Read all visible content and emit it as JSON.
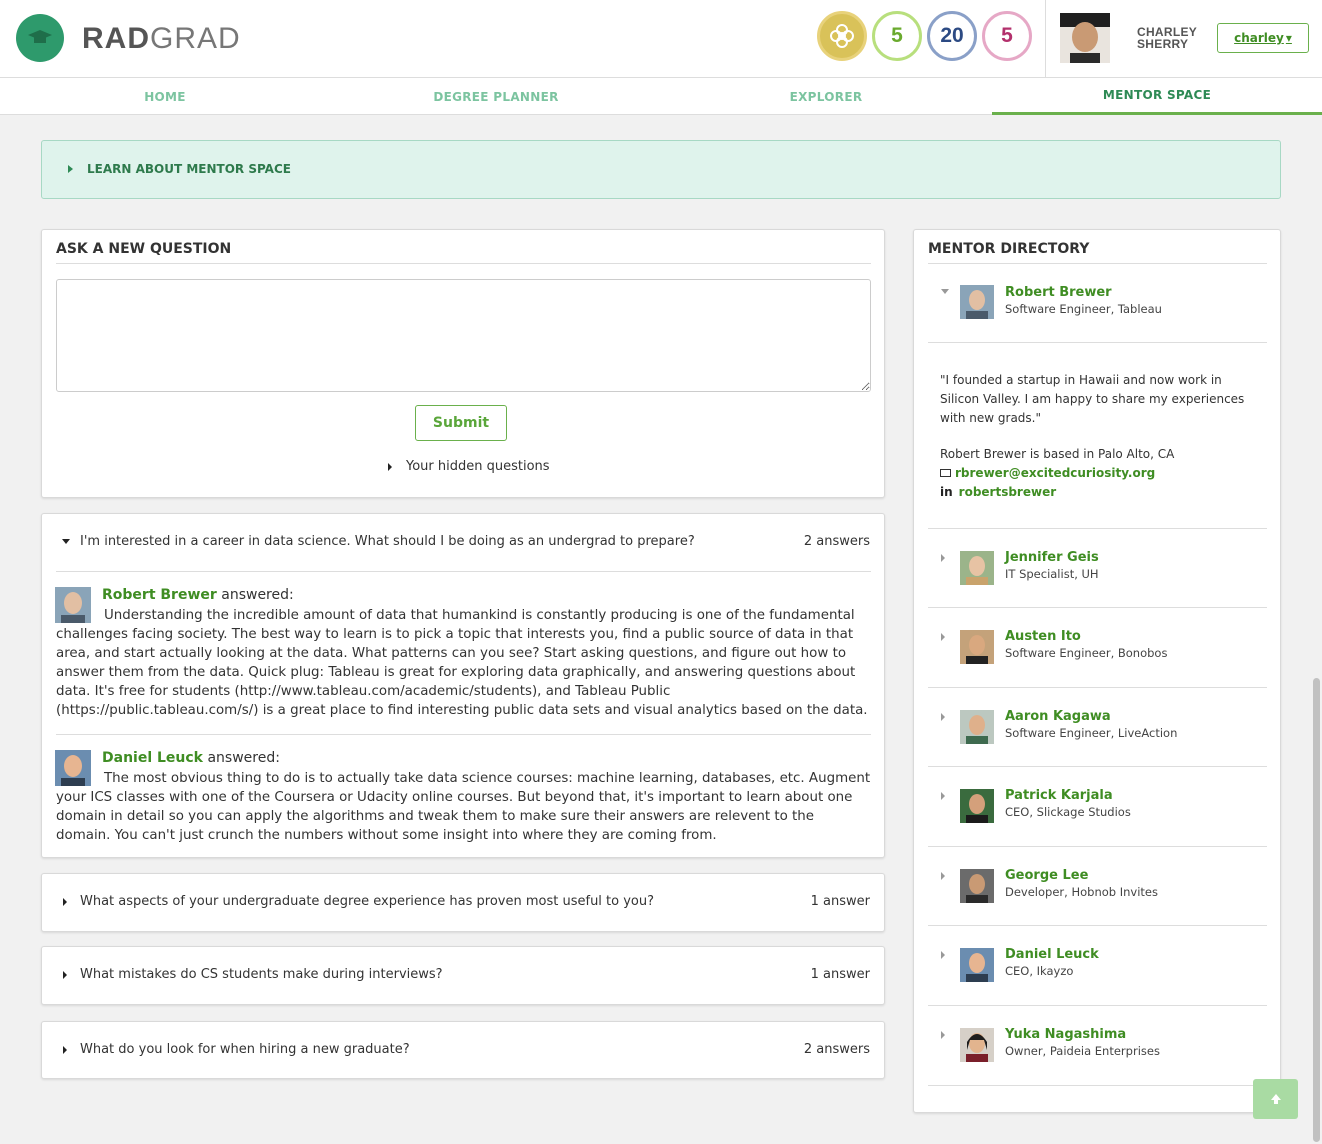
{
  "brand": {
    "strong": "RAD",
    "light": "GRAD"
  },
  "badges": [
    {
      "kind": "flower",
      "value": ""
    },
    {
      "kind": "green",
      "value": "5"
    },
    {
      "kind": "blue",
      "value": "20"
    },
    {
      "kind": "pink",
      "value": "5"
    }
  ],
  "user": {
    "first": "CHARLEY",
    "last": "SHERRY",
    "menu_label": "charley",
    "caret": "▾"
  },
  "nav": [
    {
      "label": "HOME",
      "active": false
    },
    {
      "label": "DEGREE PLANNER",
      "active": false
    },
    {
      "label": "EXPLORER",
      "active": false
    },
    {
      "label": "MENTOR SPACE",
      "active": true
    }
  ],
  "learn_banner": "LEARN ABOUT MENTOR SPACE",
  "ask": {
    "title": "ASK A NEW QUESTION",
    "submit": "Submit",
    "hidden_label": "Your hidden questions"
  },
  "questions": [
    {
      "text": "I'm interested in a career in data science. What should I be doing as an undergrad to prepare?",
      "count": "2 answers",
      "expanded": true,
      "answers": [
        {
          "name": "Robert Brewer",
          "answered": " answered:",
          "body": "Understanding the incredible amount of data that humankind is constantly producing is one of the fundamental challenges facing society. The best way to learn is to pick a topic that interests you, find a public source of data in that area, and start actually looking at the data. What patterns can you see? Start asking questions, and figure out how to answer them from the data. Quick plug: Tableau is great for exploring data graphically, and answering questions about data. It's free for students (http://www.tableau.com/academic/students), and Tableau Public (https://public.tableau.com/s/) is a great place to find interesting public data sets and visual analytics based on the data."
        },
        {
          "name": "Daniel Leuck",
          "answered": " answered:",
          "body": "The most obvious thing to do is to actually take data science courses: machine learning, databases, etc. Augment your ICS classes with one of the Coursera or Udacity online courses. But beyond that, it's important to learn about one domain in detail so you can apply the algorithms and tweak them to make sure their answers are relevent to the domain. You can't just crunch the numbers without some insight into where they are coming from."
        }
      ]
    },
    {
      "text": "What aspects of your undergraduate degree experience has proven most useful to you?",
      "count": "1 answer",
      "expanded": false
    },
    {
      "text": "What mistakes do CS students make during interviews?",
      "count": "1 answer",
      "expanded": false
    },
    {
      "text": "What do you look for when hiring a new graduate?",
      "count": "2 answers",
      "expanded": false
    }
  ],
  "directory": {
    "title": "MENTOR DIRECTORY",
    "expanded": {
      "name": "Robert Brewer",
      "role": "Software Engineer, Tableau",
      "quote": "\"I founded a startup in Hawaii and now work in Silicon Valley. I am happy to share my experiences with new grads.\"",
      "location": "Robert Brewer is based in Palo Alto, CA",
      "email": "rbrewer@excitedcuriosity.org",
      "linkedin_icon": "in",
      "linkedin": "robertsbrewer"
    },
    "mentors": [
      {
        "name": "Jennifer Geis",
        "role": "IT Specialist, UH"
      },
      {
        "name": "Austen Ito",
        "role": "Software Engineer, Bonobos"
      },
      {
        "name": "Aaron Kagawa",
        "role": "Software Engineer, LiveAction"
      },
      {
        "name": "Patrick Karjala",
        "role": "CEO, Slickage Studios"
      },
      {
        "name": "George Lee",
        "role": "Developer, Hobnob Invites"
      },
      {
        "name": "Daniel Leuck",
        "role": "CEO, Ikayzo"
      },
      {
        "name": "Yuka Nagashima",
        "role": "Owner, Paideia Enterprises"
      }
    ]
  },
  "colors": {
    "accent": "#3f8d23",
    "teal": "#2e9a6c",
    "banner": "#dff3ec"
  },
  "icons": {
    "scroll_top": "arrow-up-icon",
    "email": "envelope-icon",
    "linkedin": "linkedin-icon"
  }
}
